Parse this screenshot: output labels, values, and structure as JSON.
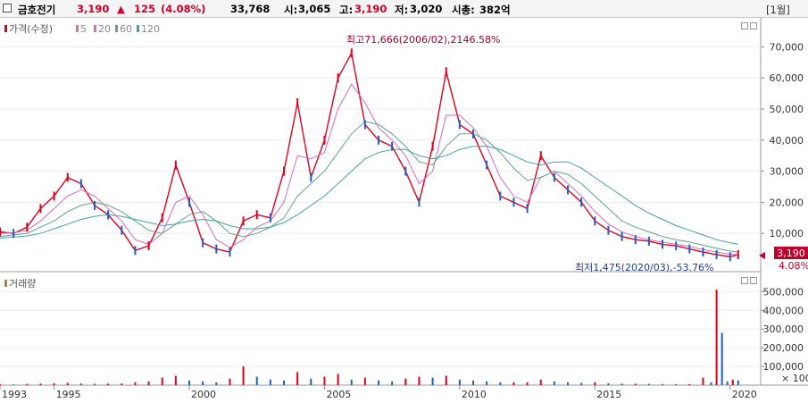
{
  "header": {
    "name": "금호전기",
    "price": "3,190",
    "change_arrow": "▲",
    "change": "125",
    "change_pct": "(4.08%)",
    "volume": "33,768",
    "open_label": "시:",
    "open": "3,065",
    "high_label": "고:",
    "high": "3,190",
    "low_label": "저:",
    "low": "3,020",
    "mcap_label": "시총:",
    "mcap": "382억",
    "period": "[1월]"
  },
  "colors": {
    "up": "#e0001b",
    "down": "#1f5fbf",
    "ma5": "#e070a0",
    "ma20": "#d06cc8",
    "ma60": "#5aa58a",
    "ma120": "#40a0a8"
  },
  "chart_data": [
    {
      "type": "line",
      "legend": [
        "가격(수정)",
        "5",
        "20",
        "60",
        "120"
      ],
      "x": [
        1993.0,
        1993.5,
        1994.0,
        1994.5,
        1995.0,
        1995.5,
        1996.0,
        1996.5,
        1997.0,
        1997.5,
        1998.0,
        1998.5,
        1999.0,
        1999.5,
        2000.0,
        2000.5,
        2001.0,
        2001.5,
        2002.0,
        2002.5,
        2003.0,
        2003.5,
        2004.0,
        2004.5,
        2005.0,
        2005.5,
        2006.0,
        2006.5,
        2007.0,
        2007.5,
        2008.0,
        2008.5,
        2009.0,
        2009.5,
        2010.0,
        2010.5,
        2011.0,
        2011.5,
        2012.0,
        2012.5,
        2013.0,
        2013.5,
        2014.0,
        2014.5,
        2015.0,
        2015.5,
        2016.0,
        2016.5,
        2017.0,
        2017.5,
        2018.0,
        2018.5,
        2019.0,
        2019.5,
        2020.0,
        2020.3
      ],
      "series": [
        {
          "name": "가격(수정)",
          "values": [
            10500,
            10000,
            12000,
            18000,
            22000,
            28000,
            26000,
            19000,
            16000,
            11000,
            4500,
            6000,
            15000,
            32000,
            20000,
            7000,
            5000,
            4000,
            14000,
            16000,
            15000,
            30000,
            52000,
            28000,
            40000,
            60000,
            68000,
            45000,
            40000,
            38000,
            30000,
            20000,
            38000,
            62000,
            45000,
            42000,
            32000,
            22000,
            20000,
            18000,
            35000,
            28000,
            24000,
            20000,
            14000,
            11000,
            9000,
            8000,
            7500,
            6500,
            6000,
            5000,
            4000,
            3200,
            2500,
            3190
          ]
        },
        {
          "name": "20",
          "values": [
            10000,
            10200,
            11000,
            14000,
            18000,
            22000,
            24000,
            22000,
            18000,
            14000,
            8000,
            6500,
            10000,
            20000,
            22000,
            16000,
            8000,
            5500,
            8000,
            12000,
            14000,
            20000,
            35000,
            34000,
            36000,
            50000,
            58000,
            52000,
            44000,
            40000,
            35000,
            26000,
            30000,
            48000,
            48000,
            44000,
            38000,
            28000,
            22000,
            20000,
            28000,
            30000,
            26000,
            22000,
            17000,
            13000,
            10500,
            9000,
            8000,
            7200,
            6500,
            5800,
            4800,
            4000,
            3300,
            3200
          ]
        },
        {
          "name": "60",
          "values": [
            9000,
            9500,
            10000,
            12000,
            14000,
            17000,
            19000,
            20000,
            19000,
            17000,
            14000,
            11000,
            10000,
            13000,
            16000,
            17000,
            14000,
            10000,
            9000,
            10000,
            12000,
            15000,
            22000,
            26000,
            30000,
            36000,
            42000,
            46000,
            45000,
            42000,
            38000,
            33000,
            32000,
            38000,
            42000,
            42000,
            40000,
            36000,
            31000,
            27000,
            28000,
            30000,
            29000,
            26000,
            22000,
            18000,
            14000,
            12000,
            10500,
            9000,
            8000,
            7200,
            6200,
            5200,
            4300,
            4000
          ]
        },
        {
          "name": "120",
          "values": [
            8500,
            8800,
            9200,
            10000,
            11500,
            13000,
            14500,
            15500,
            16000,
            15500,
            14500,
            13500,
            12500,
            13000,
            14000,
            14500,
            14000,
            12500,
            11500,
            11500,
            12000,
            13500,
            16000,
            19000,
            22000,
            26000,
            30000,
            34000,
            36000,
            37000,
            37000,
            35000,
            34000,
            35000,
            37000,
            38000,
            38000,
            37000,
            35000,
            33000,
            32000,
            33000,
            33000,
            31000,
            28000,
            25000,
            22000,
            19000,
            16500,
            14500,
            12500,
            11000,
            9500,
            8000,
            7000,
            6500
          ]
        }
      ],
      "yticks": [
        "70,000",
        "60,000",
        "50,000",
        "40,000",
        "30,000",
        "20,000",
        "10,000"
      ],
      "ylim": [
        0,
        75000
      ],
      "last_price_label": "3,190",
      "last_pct_label": "4.08%",
      "annotations": {
        "high": "최고71,666(2006/02),2146.58%",
        "low": "최저1,475(2020/03),-53.76%"
      }
    },
    {
      "type": "bar",
      "legend": [
        "거래량"
      ],
      "yticks": [
        "500,000",
        "400,000",
        "300,000",
        "200,000",
        "100,000"
      ],
      "yunit": "× 100",
      "ylim": [
        0,
        540000
      ],
      "x": [
        1993.0,
        1993.5,
        1994.0,
        1994.5,
        1995.0,
        1995.5,
        1996.0,
        1996.5,
        1997.0,
        1997.5,
        1998.0,
        1998.5,
        1999.0,
        1999.5,
        2000.0,
        2000.5,
        2001.0,
        2001.5,
        2002.0,
        2002.5,
        2003.0,
        2003.5,
        2004.0,
        2004.5,
        2005.0,
        2005.5,
        2006.0,
        2006.5,
        2007.0,
        2007.5,
        2008.0,
        2008.5,
        2009.0,
        2009.5,
        2010.0,
        2010.5,
        2011.0,
        2011.5,
        2012.0,
        2012.5,
        2013.0,
        2013.5,
        2014.0,
        2014.5,
        2015.0,
        2015.5,
        2016.0,
        2016.5,
        2017.0,
        2017.5,
        2018.0,
        2018.5,
        2019.0,
        2019.3,
        2019.5,
        2019.7,
        2019.9,
        2020.1,
        2020.3
      ],
      "values": [
        5000,
        4000,
        6000,
        8000,
        10000,
        12000,
        9000,
        7000,
        8000,
        9000,
        15000,
        20000,
        40000,
        50000,
        25000,
        20000,
        15000,
        35000,
        100000,
        45000,
        30000,
        25000,
        70000,
        35000,
        45000,
        60000,
        30000,
        40000,
        25000,
        20000,
        35000,
        45000,
        40000,
        50000,
        30000,
        25000,
        20000,
        15000,
        15000,
        15000,
        30000,
        20000,
        15000,
        12000,
        15000,
        10000,
        8000,
        8000,
        7000,
        6000,
        5000,
        5000,
        40000,
        15000,
        510000,
        280000,
        20000,
        30000,
        25000
      ]
    }
  ],
  "xaxis": {
    "ticks": [
      "1993",
      "1995",
      "2000",
      "2005",
      "2010",
      "2015",
      "2020"
    ]
  }
}
